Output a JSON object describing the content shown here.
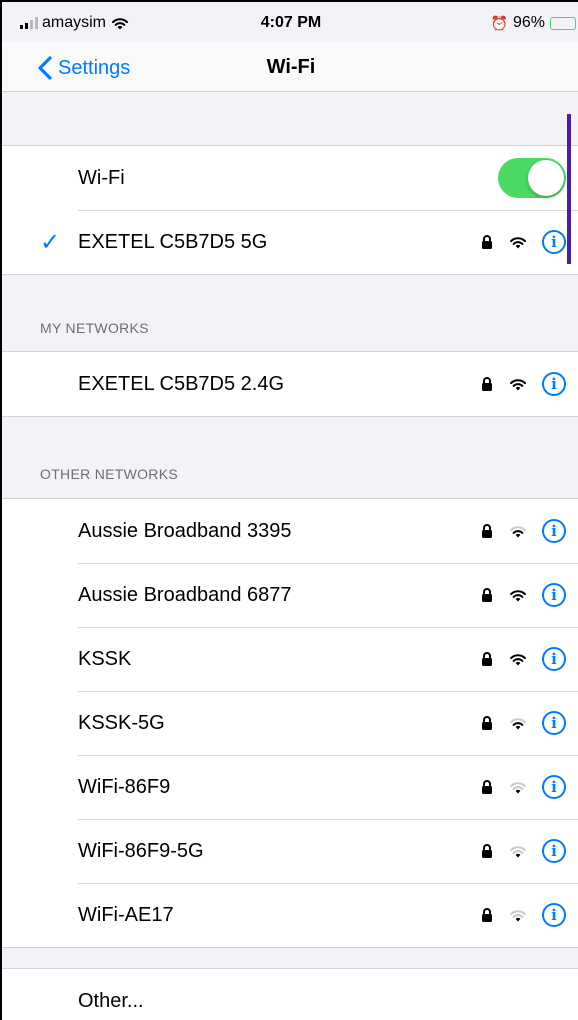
{
  "status_bar": {
    "carrier": "amaysim",
    "time": "4:07 PM",
    "battery": "96%",
    "battery_level": 0.96
  },
  "nav": {
    "back_label": "Settings",
    "title": "Wi-Fi"
  },
  "wifi_toggle": {
    "label": "Wi-Fi",
    "on": true
  },
  "connected_network": {
    "name": "EXETEL C5B7D5 5G",
    "secured": true,
    "signal": "full"
  },
  "my_networks": {
    "header": "MY NETWORKS",
    "items": [
      {
        "name": "EXETEL C5B7D5 2.4G",
        "secured": true,
        "signal": "full"
      }
    ]
  },
  "other_networks": {
    "header": "OTHER NETWORKS",
    "items": [
      {
        "name": "Aussie Broadband 3395",
        "secured": true,
        "signal": "medium"
      },
      {
        "name": "Aussie Broadband 6877",
        "secured": true,
        "signal": "full"
      },
      {
        "name": "KSSK",
        "secured": true,
        "signal": "full"
      },
      {
        "name": "KSSK-5G",
        "secured": true,
        "signal": "medium"
      },
      {
        "name": "WiFi-86F9",
        "secured": true,
        "signal": "weak"
      },
      {
        "name": "WiFi-86F9-5G",
        "secured": true,
        "signal": "weak"
      },
      {
        "name": "WiFi-AE17",
        "secured": true,
        "signal": "weak"
      }
    ],
    "other_label": "Other..."
  },
  "icons": {
    "lock": "lock-icon",
    "wifi": "wifi-signal-icon",
    "info": "info-icon",
    "check": "checkmark-icon",
    "back": "chevron-left-icon"
  },
  "colors": {
    "accent": "#007aff",
    "toggle_on": "#4cd964",
    "background": "#f2f2f7"
  }
}
